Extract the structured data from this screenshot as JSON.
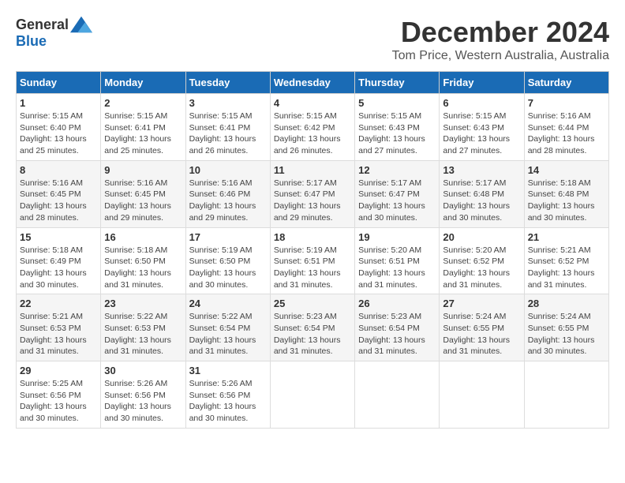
{
  "header": {
    "logo_general": "General",
    "logo_blue": "Blue",
    "month_title": "December 2024",
    "subtitle": "Tom Price, Western Australia, Australia"
  },
  "weekdays": [
    "Sunday",
    "Monday",
    "Tuesday",
    "Wednesday",
    "Thursday",
    "Friday",
    "Saturday"
  ],
  "weeks": [
    [
      {
        "day": "1",
        "sunrise": "5:15 AM",
        "sunset": "6:40 PM",
        "daylight": "13 hours and 25 minutes."
      },
      {
        "day": "2",
        "sunrise": "5:15 AM",
        "sunset": "6:41 PM",
        "daylight": "13 hours and 25 minutes."
      },
      {
        "day": "3",
        "sunrise": "5:15 AM",
        "sunset": "6:41 PM",
        "daylight": "13 hours and 26 minutes."
      },
      {
        "day": "4",
        "sunrise": "5:15 AM",
        "sunset": "6:42 PM",
        "daylight": "13 hours and 26 minutes."
      },
      {
        "day": "5",
        "sunrise": "5:15 AM",
        "sunset": "6:43 PM",
        "daylight": "13 hours and 27 minutes."
      },
      {
        "day": "6",
        "sunrise": "5:15 AM",
        "sunset": "6:43 PM",
        "daylight": "13 hours and 27 minutes."
      },
      {
        "day": "7",
        "sunrise": "5:16 AM",
        "sunset": "6:44 PM",
        "daylight": "13 hours and 28 minutes."
      }
    ],
    [
      {
        "day": "8",
        "sunrise": "5:16 AM",
        "sunset": "6:45 PM",
        "daylight": "13 hours and 28 minutes."
      },
      {
        "day": "9",
        "sunrise": "5:16 AM",
        "sunset": "6:45 PM",
        "daylight": "13 hours and 29 minutes."
      },
      {
        "day": "10",
        "sunrise": "5:16 AM",
        "sunset": "6:46 PM",
        "daylight": "13 hours and 29 minutes."
      },
      {
        "day": "11",
        "sunrise": "5:17 AM",
        "sunset": "6:47 PM",
        "daylight": "13 hours and 29 minutes."
      },
      {
        "day": "12",
        "sunrise": "5:17 AM",
        "sunset": "6:47 PM",
        "daylight": "13 hours and 30 minutes."
      },
      {
        "day": "13",
        "sunrise": "5:17 AM",
        "sunset": "6:48 PM",
        "daylight": "13 hours and 30 minutes."
      },
      {
        "day": "14",
        "sunrise": "5:18 AM",
        "sunset": "6:48 PM",
        "daylight": "13 hours and 30 minutes."
      }
    ],
    [
      {
        "day": "15",
        "sunrise": "5:18 AM",
        "sunset": "6:49 PM",
        "daylight": "13 hours and 30 minutes."
      },
      {
        "day": "16",
        "sunrise": "5:18 AM",
        "sunset": "6:50 PM",
        "daylight": "13 hours and 31 minutes."
      },
      {
        "day": "17",
        "sunrise": "5:19 AM",
        "sunset": "6:50 PM",
        "daylight": "13 hours and 30 minutes."
      },
      {
        "day": "18",
        "sunrise": "5:19 AM",
        "sunset": "6:51 PM",
        "daylight": "13 hours and 31 minutes."
      },
      {
        "day": "19",
        "sunrise": "5:20 AM",
        "sunset": "6:51 PM",
        "daylight": "13 hours and 31 minutes."
      },
      {
        "day": "20",
        "sunrise": "5:20 AM",
        "sunset": "6:52 PM",
        "daylight": "13 hours and 31 minutes."
      },
      {
        "day": "21",
        "sunrise": "5:21 AM",
        "sunset": "6:52 PM",
        "daylight": "13 hours and 31 minutes."
      }
    ],
    [
      {
        "day": "22",
        "sunrise": "5:21 AM",
        "sunset": "6:53 PM",
        "daylight": "13 hours and 31 minutes."
      },
      {
        "day": "23",
        "sunrise": "5:22 AM",
        "sunset": "6:53 PM",
        "daylight": "13 hours and 31 minutes."
      },
      {
        "day": "24",
        "sunrise": "5:22 AM",
        "sunset": "6:54 PM",
        "daylight": "13 hours and 31 minutes."
      },
      {
        "day": "25",
        "sunrise": "5:23 AM",
        "sunset": "6:54 PM",
        "daylight": "13 hours and 31 minutes."
      },
      {
        "day": "26",
        "sunrise": "5:23 AM",
        "sunset": "6:54 PM",
        "daylight": "13 hours and 31 minutes."
      },
      {
        "day": "27",
        "sunrise": "5:24 AM",
        "sunset": "6:55 PM",
        "daylight": "13 hours and 31 minutes."
      },
      {
        "day": "28",
        "sunrise": "5:24 AM",
        "sunset": "6:55 PM",
        "daylight": "13 hours and 30 minutes."
      }
    ],
    [
      {
        "day": "29",
        "sunrise": "5:25 AM",
        "sunset": "6:56 PM",
        "daylight": "13 hours and 30 minutes."
      },
      {
        "day": "30",
        "sunrise": "5:26 AM",
        "sunset": "6:56 PM",
        "daylight": "13 hours and 30 minutes."
      },
      {
        "day": "31",
        "sunrise": "5:26 AM",
        "sunset": "6:56 PM",
        "daylight": "13 hours and 30 minutes."
      },
      null,
      null,
      null,
      null
    ]
  ]
}
